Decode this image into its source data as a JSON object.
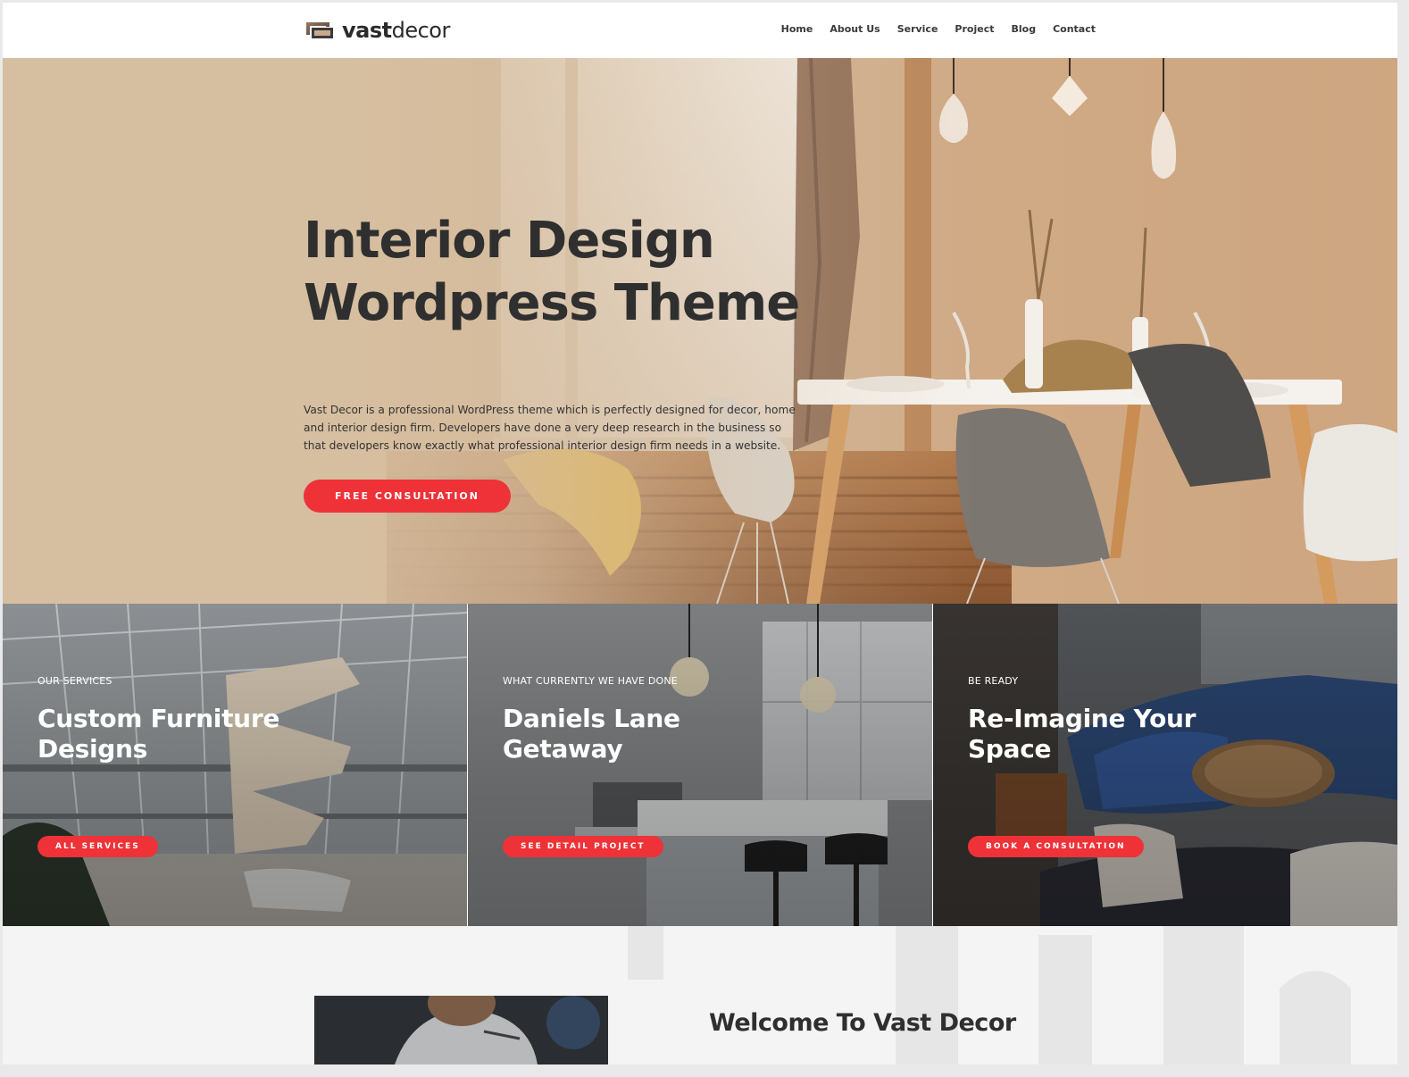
{
  "brand": {
    "name_bold": "vast",
    "name_light": "decor",
    "logo_icon": "frame-logo-icon"
  },
  "nav": {
    "items": [
      "Home",
      "About Us",
      "Service",
      "Project",
      "Blog",
      "Contact"
    ]
  },
  "hero": {
    "title_line1": "Interior Design",
    "title_line2": "Wordpress Theme",
    "description": "Vast Decor is a professional WordPress theme which is perfectly designed for decor, home and interior design firm. Developers have done a very deep research in the business so that developers know exactly what professional interior design firm needs in a website.",
    "cta": "FREE CONSULTATION"
  },
  "panels": [
    {
      "eyebrow": "OUR SERVICES",
      "title_line1": "Custom Furniture",
      "title_line2": "Designs",
      "button": "ALL SERVICES"
    },
    {
      "eyebrow": "WHAT CURRENTLY WE HAVE DONE",
      "title_line1": "Daniels Lane",
      "title_line2": "Getaway",
      "button": "SEE DETAIL PROJECT"
    },
    {
      "eyebrow": "BE READY",
      "title_line1": "Re-Imagine Your",
      "title_line2": "Space",
      "button": "BOOK A CONSULTATION"
    }
  ],
  "welcome": {
    "title": "Welcome To Vast Decor"
  },
  "colors": {
    "accent": "#ee3238",
    "hero_tone": "#d6bea0",
    "text_dark": "#2f2f2f"
  }
}
